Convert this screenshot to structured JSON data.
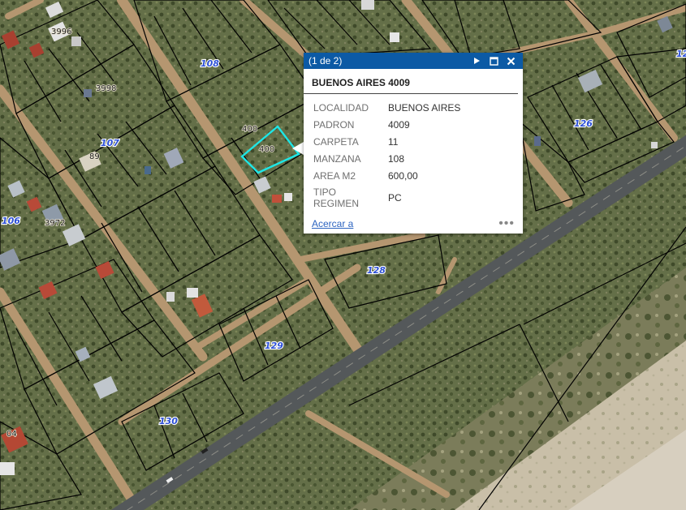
{
  "map": {
    "block_labels": [
      {
        "id": "108a",
        "text": "108"
      },
      {
        "id": "107",
        "text": "107"
      },
      {
        "id": "106",
        "text": "106"
      },
      {
        "id": "126",
        "text": "126"
      },
      {
        "id": "128",
        "text": "128"
      },
      {
        "id": "129",
        "text": "129"
      },
      {
        "id": "130",
        "text": "130"
      },
      {
        "id": "12x",
        "text": "12"
      }
    ],
    "lot_labels": [
      {
        "id": "a",
        "text": "3996"
      },
      {
        "id": "b",
        "text": "3998"
      },
      {
        "id": "c",
        "text": "89"
      },
      {
        "id": "d",
        "text": "3972"
      },
      {
        "id": "e",
        "text": "400"
      },
      {
        "id": "f",
        "text": "400"
      },
      {
        "id": "g",
        "text": "04"
      }
    ],
    "colors": {
      "road": "#54585a",
      "dirt": "#b59670",
      "parcel_line": "#000000",
      "highlight": "#1ee6e6",
      "block_label": "#2c4fd6"
    }
  },
  "popup": {
    "count": "(1 de 2)",
    "title": "BUENOS AIRES 4009",
    "attributes": [
      {
        "key": "LOCALIDAD",
        "value": "BUENOS AIRES"
      },
      {
        "key": "PADRON",
        "value": "4009"
      },
      {
        "key": "CARPETA",
        "value": "11"
      },
      {
        "key": "MANZANA",
        "value": "108"
      },
      {
        "key": "AREA M2",
        "value": "600,00"
      },
      {
        "key": "TIPO REGIMEN",
        "value": "PC"
      }
    ],
    "zoom_link": "Acercar a",
    "icons": {
      "next": "play-icon",
      "maximize": "maximize-icon",
      "close": "close-icon",
      "more": "more-icon"
    },
    "header_color": "#0c5aa5"
  }
}
